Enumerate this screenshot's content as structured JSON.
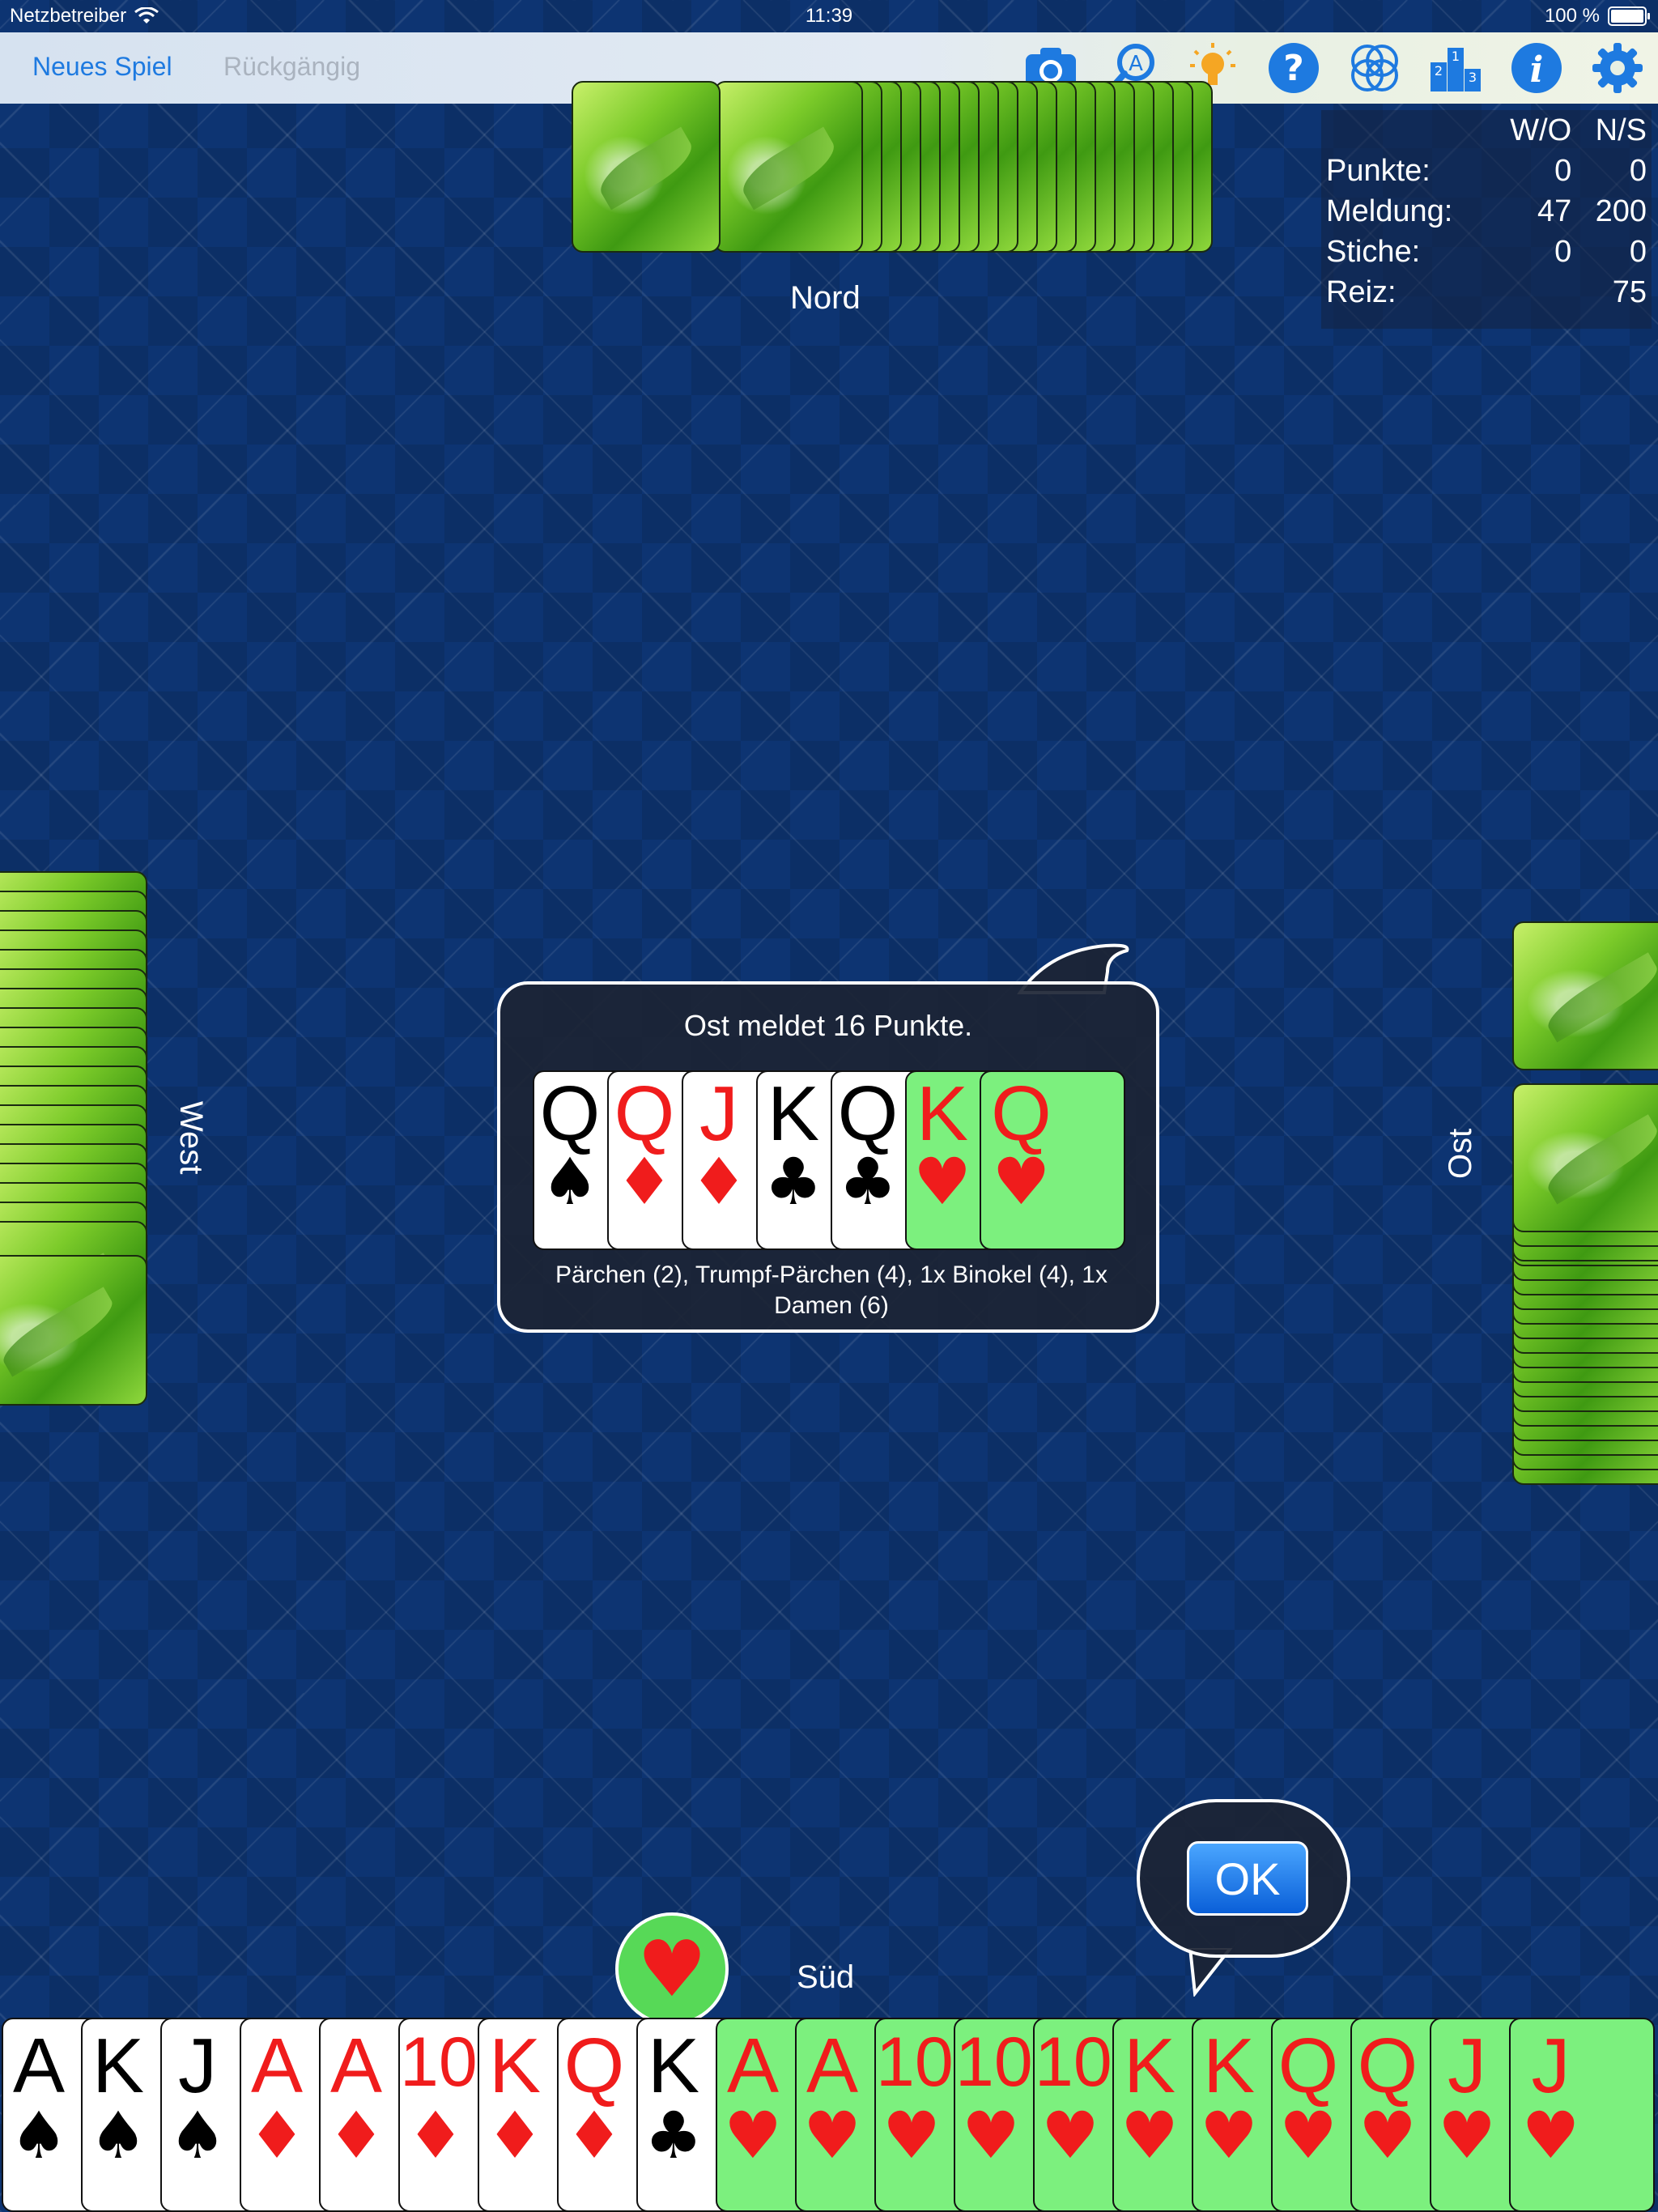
{
  "status_bar": {
    "carrier": "Netzbetreiber",
    "time": "11:39",
    "battery": "100 %"
  },
  "toolbar": {
    "new_game": "Neues Spiel",
    "undo": "Rückgängig",
    "icons": [
      "camera-icon",
      "magnifier-icon",
      "hint-bulb-icon",
      "help-icon",
      "rings-icon",
      "ranking-icon",
      "info-icon",
      "settings-icon"
    ]
  },
  "score": {
    "col1": "W/O",
    "col2": "N/S",
    "rows": [
      {
        "label": "Punkte:",
        "wo": "0",
        "ns": "0"
      },
      {
        "label": "Meldung:",
        "wo": "47",
        "ns": "200"
      },
      {
        "label": "Stiche:",
        "wo": "0",
        "ns": "0"
      },
      {
        "label": "Reiz:",
        "wo": "",
        "ns": "75"
      }
    ]
  },
  "players": {
    "north": "Nord",
    "west": "West",
    "east": "Ost",
    "south": "Süd"
  },
  "meld": {
    "title": "Ost meldet 16 Punkte.",
    "description": "Pärchen (2), Trumpf-Pärchen (4), 1x Binokel (4), 1x Damen (6)",
    "cards": [
      {
        "rank": "Q",
        "suit": "♠",
        "color": "black",
        "bg": "white"
      },
      {
        "rank": "Q",
        "suit": "♦",
        "color": "red",
        "bg": "white"
      },
      {
        "rank": "J",
        "suit": "♦",
        "color": "red",
        "bg": "white"
      },
      {
        "rank": "K",
        "suit": "♣",
        "color": "black",
        "bg": "white"
      },
      {
        "rank": "Q",
        "suit": "♣",
        "color": "black",
        "bg": "white"
      },
      {
        "rank": "K",
        "suit": "♥",
        "color": "red",
        "bg": "green"
      },
      {
        "rank": "Q",
        "suit": "♥",
        "color": "red",
        "bg": "green"
      }
    ]
  },
  "trump_suit": "♥",
  "ok_label": "OK",
  "hand": [
    {
      "rank": "A",
      "suit": "♠",
      "color": "black",
      "bg": "white"
    },
    {
      "rank": "K",
      "suit": "♠",
      "color": "black",
      "bg": "white"
    },
    {
      "rank": "J",
      "suit": "♠",
      "color": "black",
      "bg": "white"
    },
    {
      "rank": "A",
      "suit": "♦",
      "color": "red",
      "bg": "white"
    },
    {
      "rank": "A",
      "suit": "♦",
      "color": "red",
      "bg": "white"
    },
    {
      "rank": "10",
      "suit": "♦",
      "color": "red",
      "bg": "white"
    },
    {
      "rank": "K",
      "suit": "♦",
      "color": "red",
      "bg": "white"
    },
    {
      "rank": "Q",
      "suit": "♦",
      "color": "red",
      "bg": "white"
    },
    {
      "rank": "K",
      "suit": "♣",
      "color": "black",
      "bg": "white"
    },
    {
      "rank": "A",
      "suit": "♥",
      "color": "red",
      "bg": "green"
    },
    {
      "rank": "A",
      "suit": "♥",
      "color": "red",
      "bg": "green"
    },
    {
      "rank": "10",
      "suit": "♥",
      "color": "red",
      "bg": "green"
    },
    {
      "rank": "10",
      "suit": "♥",
      "color": "red",
      "bg": "green"
    },
    {
      "rank": "10",
      "suit": "♥",
      "color": "red",
      "bg": "green"
    },
    {
      "rank": "K",
      "suit": "♥",
      "color": "red",
      "bg": "green"
    },
    {
      "rank": "K",
      "suit": "♥",
      "color": "red",
      "bg": "green"
    },
    {
      "rank": "Q",
      "suit": "♥",
      "color": "red",
      "bg": "green"
    },
    {
      "rank": "Q",
      "suit": "♥",
      "color": "red",
      "bg": "green"
    },
    {
      "rank": "J",
      "suit": "♥",
      "color": "red",
      "bg": "green"
    },
    {
      "rank": "J",
      "suit": "♥",
      "color": "red",
      "bg": "green"
    }
  ],
  "opponents": {
    "north_cards": 20,
    "west_cards": 20,
    "east_cards": 20
  }
}
